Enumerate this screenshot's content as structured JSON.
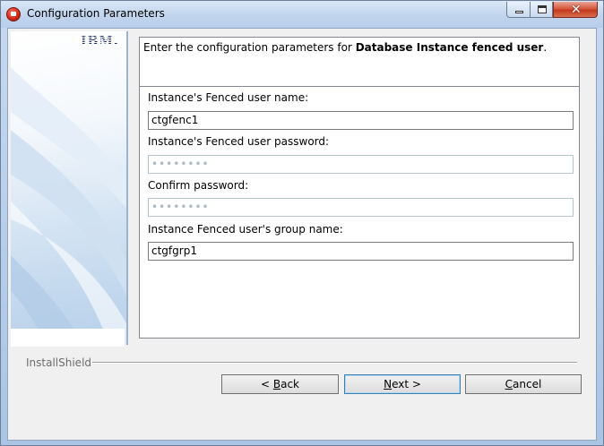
{
  "window": {
    "title": "Configuration Parameters",
    "close_glyph": "✕"
  },
  "side_panel": {
    "logo_text": "IBM."
  },
  "header": {
    "prefix": "Enter the configuration parameters for ",
    "emphasis": "Database Instance fenced user",
    "suffix": "."
  },
  "form": {
    "fenced_user_label": "Instance's Fenced user name:",
    "fenced_user_value": "ctgfenc1",
    "password_label": "Instance's Fenced user password:",
    "password_value": "••••••••",
    "confirm_label": "Confirm password:",
    "confirm_value": "••••••••",
    "group_label": "Instance Fenced user's group name:",
    "group_value": "ctgfgrp1"
  },
  "footer": {
    "brand": "InstallShield",
    "back_prefix": "< ",
    "back_mnemonic": "B",
    "back_rest": "ack",
    "next_mnemonic": "N",
    "next_rest": "ext >",
    "cancel_mnemonic": "C",
    "cancel_rest": "ancel"
  },
  "icons": {
    "title_icon": "installer-app-icon",
    "minimize": "minimize-icon",
    "maximize": "maximize-icon",
    "close": "close-icon"
  }
}
